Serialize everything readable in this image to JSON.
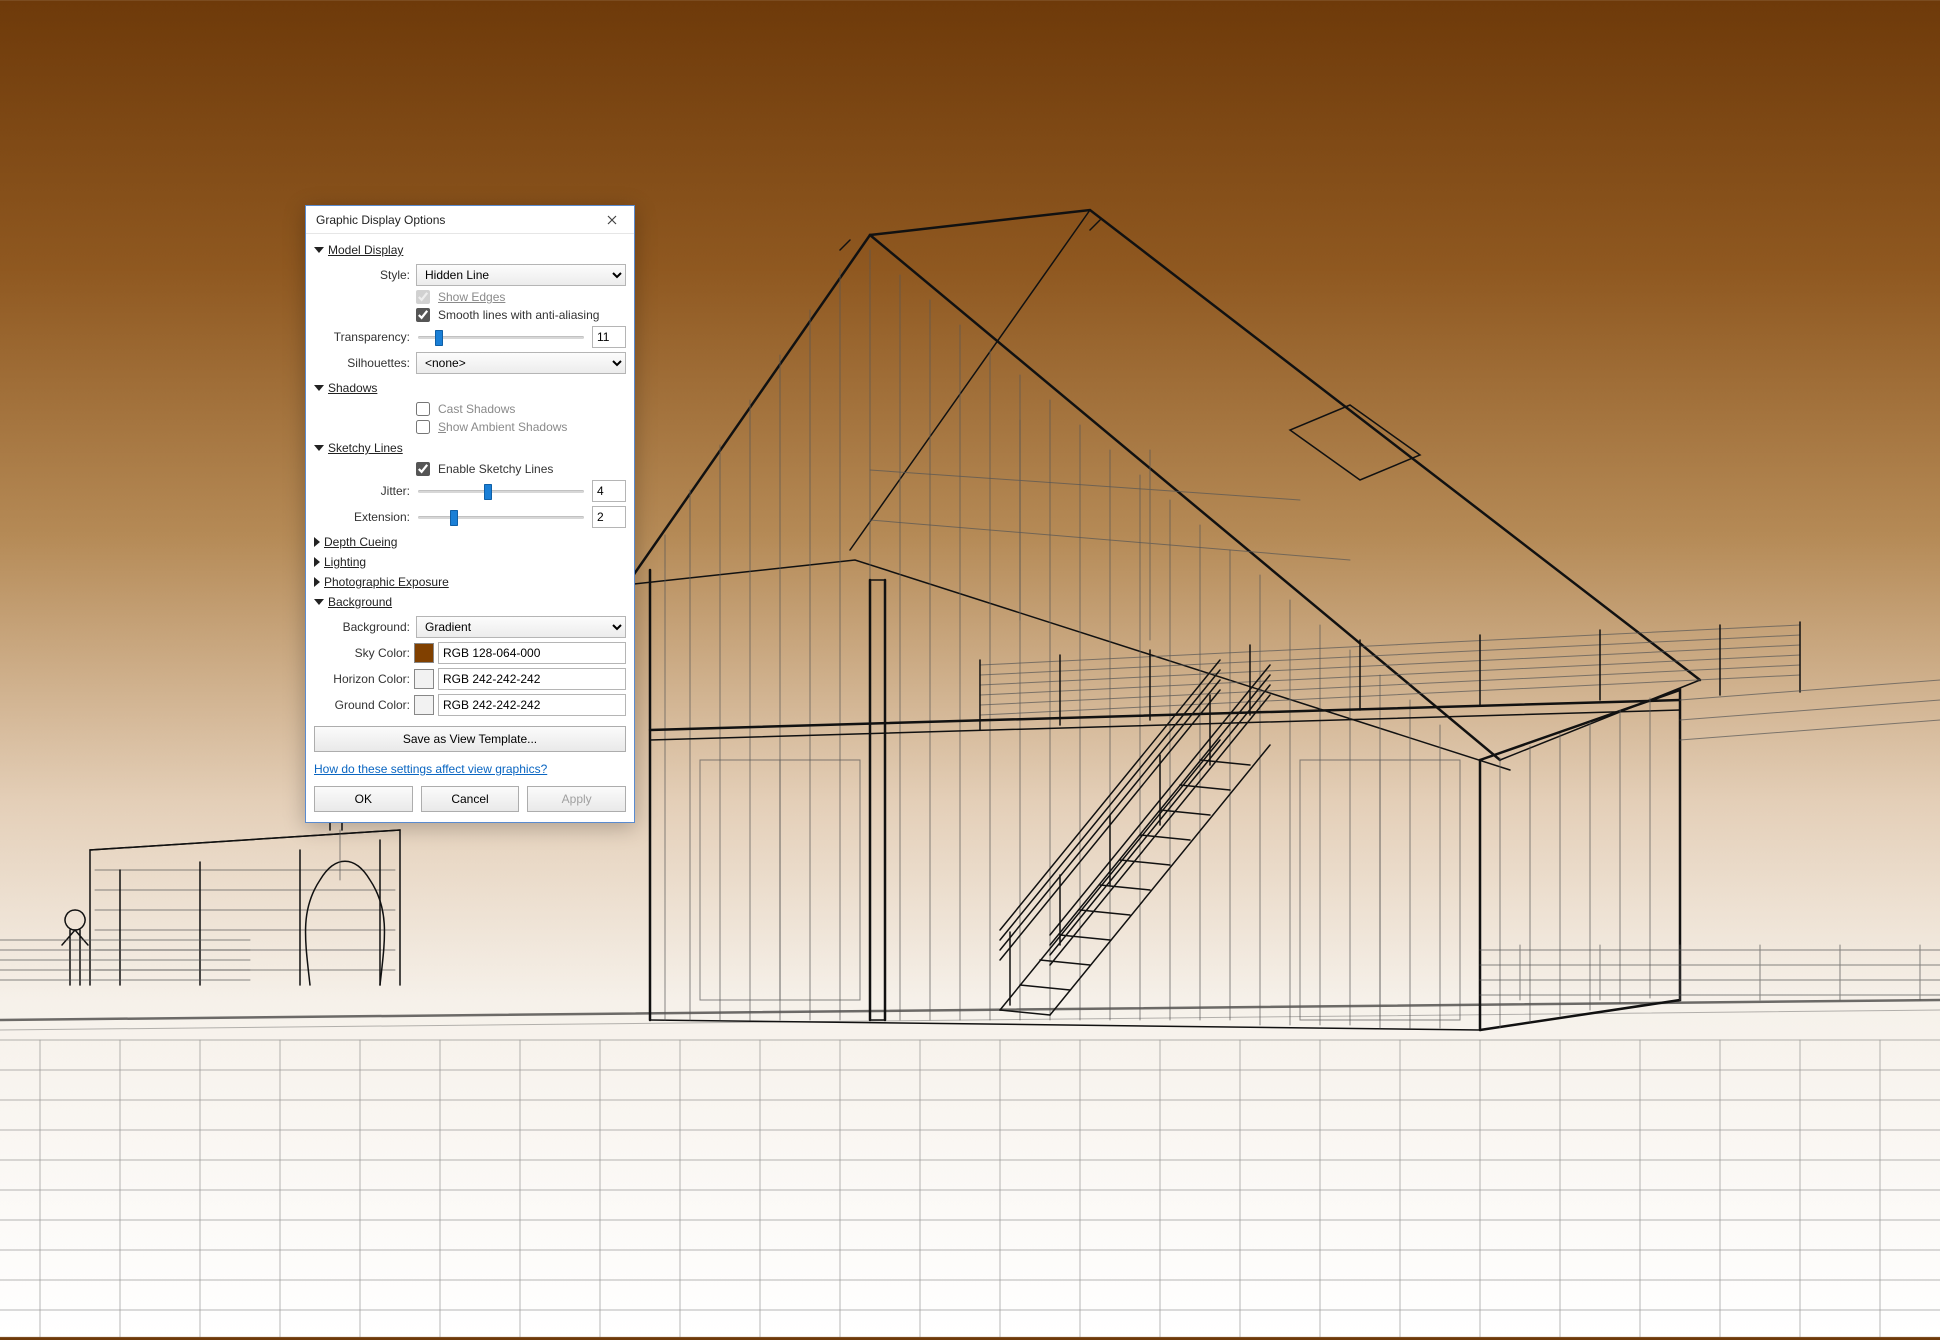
{
  "dialog": {
    "title": "Graphic Display Options",
    "sections": {
      "model_display": {
        "title": "Model Display",
        "style_label": "Style:",
        "style_value": "Hidden Line",
        "show_edges_label": "Show Edges",
        "show_edges_checked": true,
        "show_edges_disabled": true,
        "smooth_lines_label": "Smooth lines with anti-aliasing",
        "smooth_lines_checked": true,
        "transparency_label": "Transparency:",
        "transparency_value": "11",
        "transparency_pct": 11,
        "silhouettes_label": "Silhouettes:",
        "silhouettes_value": "<none>"
      },
      "shadows": {
        "title": "Shadows",
        "cast_label": "Cast Shadows",
        "cast_checked": false,
        "ambient_label": "Show Ambient Shadows",
        "ambient_checked": false
      },
      "sketchy": {
        "title": "Sketchy Lines",
        "enable_label": "Enable Sketchy Lines",
        "enable_checked": true,
        "jitter_label": "Jitter:",
        "jitter_value": "4",
        "jitter_pct": 40,
        "extension_label": "Extension:",
        "extension_value": "2",
        "extension_pct": 20
      },
      "depth_cueing_title": "Depth Cueing",
      "lighting_title": "Lighting",
      "photo_exposure_title": "Photographic Exposure",
      "background": {
        "title": "Background",
        "background_label": "Background:",
        "background_value": "Gradient",
        "sky_label": "Sky Color:",
        "sky_swatch": "#804000",
        "sky_text": "RGB 128-064-000",
        "horizon_label": "Horizon Color:",
        "horizon_swatch": "#f2f2f2",
        "horizon_text": "RGB 242-242-242",
        "ground_label": "Ground Color:",
        "ground_swatch": "#f2f2f2",
        "ground_text": "RGB 242-242-242"
      }
    },
    "save_template_label": "Save as View Template...",
    "help_link": "How do these settings affect view graphics?",
    "buttons": {
      "ok": "OK",
      "cancel": "Cancel",
      "apply": "Apply"
    }
  }
}
